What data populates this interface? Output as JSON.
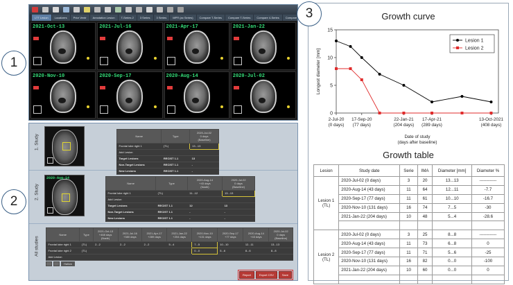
{
  "badges": [
    "1",
    "2",
    "3"
  ],
  "viewer": {
    "tabs": [
      "LTT Lesion",
      "Localizers",
      "Prior Ventr",
      "Annotation Lesion",
      "T-Series 2",
      "3 Series",
      "3 Series",
      "MPR (ax Series)",
      "Compare T-Series",
      "Compare T-Series",
      "Compare 4-Series",
      "Compare 5-Series",
      "Compare MPR"
    ],
    "scans": [
      {
        "date": "2021-Oct-13"
      },
      {
        "date": "2021-Jul-16"
      },
      {
        "date": "2021-Apr-17"
      },
      {
        "date": "2021-Jan-22"
      },
      {
        "date": "2020-Nov-10"
      },
      {
        "date": "2020-Sep-17"
      },
      {
        "date": "2020-Aug-14"
      },
      {
        "date": "2020-Jul-02"
      }
    ]
  },
  "study1": {
    "label": "1. Study",
    "headers": [
      "Name",
      "Type",
      "2020-Jul-02\n0 days\n(Baseline)"
    ],
    "rows": [
      [
        "Frontal lobe right 1",
        "(TL)",
        "13...13"
      ],
      [
        "Add Lesion",
        "",
        ""
      ],
      [
        "Target Lesions",
        "RECIST 1.1",
        "13"
      ],
      [
        "Non-Target Lesions",
        "RECIST 1.1",
        "-"
      ],
      [
        "New Lesions",
        "RECIST 1.1",
        "-"
      ]
    ]
  },
  "study2": {
    "label": "2. Study",
    "thumb_date": "2020-Aug-14",
    "headers": [
      "Name",
      "Type",
      "2020-Aug-14\n+43 days\n(Nadir)",
      "2020-Jul-02\n0 days\n(Baseline)"
    ],
    "rows": [
      [
        "Frontal lobe right 1",
        "(TL)",
        "11...12",
        "13...13"
      ],
      [
        "Add Lesion",
        "",
        "",
        ""
      ],
      [
        "Target Lesions",
        "RECIST 1.1",
        "12",
        "13"
      ],
      [
        "Non-Target Lesions",
        "RECIST 1.1",
        "-",
        "-"
      ],
      [
        "New Lesions",
        "RECIST 1.1",
        "-",
        "-"
      ]
    ]
  },
  "all_studies": {
    "label": "All studies",
    "headers": [
      "Name",
      "Type",
      "2021-Oct-13\n+468 days\n(Nadir)",
      "2021-Jul-16\n+380 days",
      "2021-Apr-17\n+289 days",
      "2021-Jan-22\n+204 days",
      "2020-Nov-10\n+131 days",
      "2020-Sep-17\n+77 days",
      "2020-Aug-14\n+43 days",
      "2020-Jul-02\n0 days\n(Baseline)"
    ],
    "rows": [
      [
        "Frontal lobe right 1",
        "(TL)",
        "2...2",
        "2...2",
        "2...2",
        "5...4",
        "7...5",
        "10...10",
        "12...11",
        "13...13"
      ],
      [
        "Frontal lobe right 2",
        "(TL)",
        "",
        "",
        "",
        "",
        "0...0",
        "5...6",
        "8...6",
        "8...8"
      ],
      [
        "Add Lesion",
        "",
        "",
        "",
        "",
        "",
        "",
        "",
        "",
        ""
      ]
    ],
    "misc_button": "Hallow",
    "buttons": [
      "Report",
      "Export CSV",
      "Save"
    ]
  },
  "growth_curve": {
    "title": "Growth curve"
  },
  "chart_data": {
    "type": "line",
    "title": "Growth curve",
    "xlabel": "Date of study\n(days after baseline)",
    "ylabel": "Longest diameter [mm]",
    "x": [
      0,
      43,
      77,
      131,
      204,
      289,
      380,
      468
    ],
    "x_ticks": [
      {
        "x": 0,
        "label": [
          "2-Jul-20",
          "(0 days)"
        ]
      },
      {
        "x": 77,
        "label": [
          "17-Sep-20",
          "(77 days)"
        ]
      },
      {
        "x": 204,
        "label": [
          "22-Jan-21",
          "(204 days)"
        ]
      },
      {
        "x": 289,
        "label": [
          "17-Apr-21",
          "(289 days)"
        ]
      },
      {
        "x": 468,
        "label": [
          "13-Oct-2021",
          "(408 days)"
        ]
      }
    ],
    "ylim": [
      0,
      15
    ],
    "yticks": [
      0,
      5,
      10,
      15
    ],
    "xlim": [
      0,
      490
    ],
    "series": [
      {
        "name": "Lesion 1",
        "color": "#000000",
        "values": [
          13,
          12,
          10,
          7,
          5,
          2,
          3,
          2
        ]
      },
      {
        "name": "Lesion 2",
        "color": "#e02b2b",
        "values": [
          8,
          8,
          6,
          0,
          0,
          0,
          0,
          0
        ]
      }
    ],
    "legend": "top-right",
    "grid": false
  },
  "growth_table": {
    "title": "Growth table",
    "headers": [
      "Lesion",
      "Study date",
      "Serie",
      "IMA",
      "Diameter [mm]",
      "Diameter %"
    ],
    "groups": [
      {
        "lesion": [
          "Lesion 1",
          "(TL)"
        ],
        "rows": [
          [
            "2020-Jul-02 (0 days)",
            "3",
            "20",
            "13...13",
            "------------"
          ],
          [
            "2020-Aug-14 (43 days)",
            "11",
            "64",
            "12...11",
            "-7.7"
          ],
          [
            "2020-Sep-17 (77 days)",
            "11",
            "61",
            "10...10",
            "-16.7"
          ],
          [
            "2020-Nov-10 (131 days)",
            "16",
            "74",
            "7...5",
            "-30"
          ],
          [
            "2021-Jan-22 (204 days)",
            "10",
            "48",
            "5...4",
            "-28.6"
          ]
        ]
      },
      {
        "lesion": [
          "Lesion 2",
          "(TL)"
        ],
        "rows": [
          [
            "2020-Jul-02 (0 days)",
            "3",
            "25",
            "8...8",
            "------------"
          ],
          [
            "2020-Aug-14 (43 days)",
            "11",
            "73",
            "6...8",
            "0"
          ],
          [
            "2020-Sep-17 (77 days)",
            "11",
            "71",
            "5...6",
            "-25"
          ],
          [
            "2020-Nov-10 (131 days)",
            "16",
            "82",
            "0...0",
            "-100"
          ],
          [
            "2021-Jan-22 (204 days)",
            "10",
            "60",
            "0...0",
            "0"
          ]
        ]
      }
    ]
  }
}
